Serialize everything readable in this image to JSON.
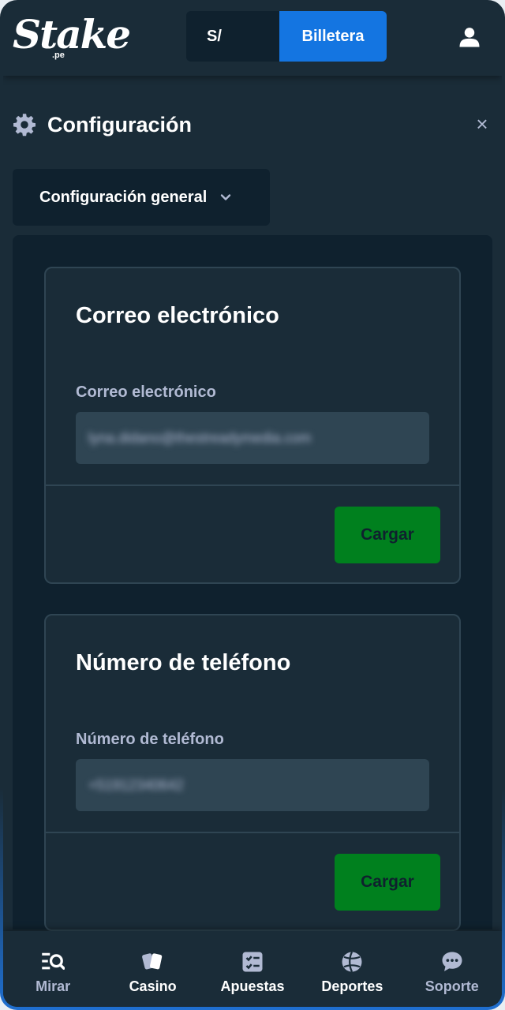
{
  "header": {
    "logo_text": "Stake",
    "logo_sub": ".pe",
    "currency": "S/",
    "wallet_label": "Billetera"
  },
  "page": {
    "title": "Configuración",
    "close_symbol": "×",
    "section_select": "Configuración general"
  },
  "email_card": {
    "title": "Correo electrónico",
    "field_label": "Correo electrónico",
    "field_value": "lyna.didano@thestreadymedia.com",
    "button_label": "Cargar"
  },
  "phone_card": {
    "title": "Número de teléfono",
    "field_label": "Número de teléfono",
    "field_value": "+51912340642",
    "button_label": "Cargar"
  },
  "nav": {
    "items": [
      {
        "label": "Mirar",
        "icon": "browse-icon"
      },
      {
        "label": "Casino",
        "icon": "cards-icon"
      },
      {
        "label": "Apuestas",
        "icon": "betslip-icon"
      },
      {
        "label": "Deportes",
        "icon": "sports-ball-icon"
      },
      {
        "label": "Soporte",
        "icon": "chat-icon"
      }
    ]
  },
  "colors": {
    "background": "#1a2c38",
    "panel": "#0f212e",
    "accent_blue": "#1475e1",
    "accent_green": "#00801e",
    "muted_text": "#b1bad3"
  }
}
